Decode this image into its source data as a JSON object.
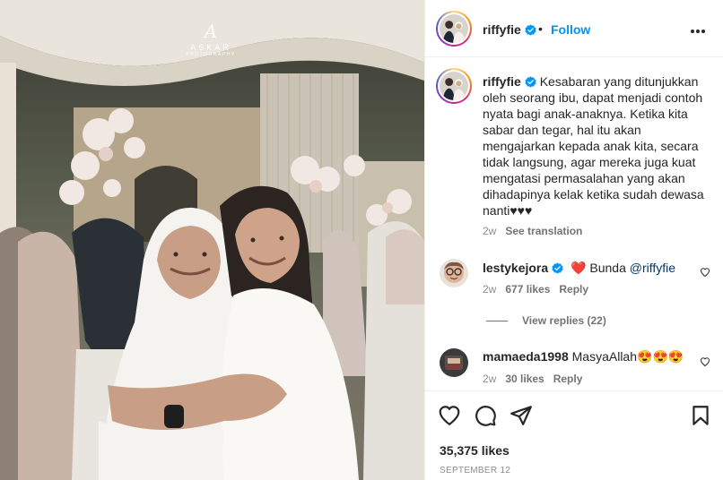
{
  "post": {
    "author": "riffyfie",
    "follow_label": "Follow",
    "separator": "•",
    "caption_text": "Kesabaran yang ditunjukkan oleh seorang ibu, dapat menjadi contoh nyata bagi anak-anaknya. Ketika kita sabar dan tegar, hal itu akan mengajarkan kepada anak kita, secara tidak langsung, agar mereka juga kuat mengatasi permasalahan yang akan dihadapinya kelak ketika sudah dewasa nanti♥♥♥",
    "caption_age": "2w",
    "see_translation": "See translation",
    "likes": "35,375 likes",
    "date": "SEPTEMBER 12"
  },
  "watermark": {
    "mark": "A",
    "name": "ASKAR",
    "sub": "PHOTOGRAPHY"
  },
  "comments": [
    {
      "user": "lestykejora",
      "heart": "❤️",
      "text": "Bunda ",
      "mention": "@riffyfie",
      "age": "2w",
      "likes": "677 likes",
      "reply": "Reply"
    },
    {
      "user": "mamaeda1998",
      "text": "MasyaAllah",
      "emojis": "😍😍😍",
      "age": "2w",
      "likes": "30 likes",
      "reply": "Reply"
    }
  ],
  "view_replies": "View replies (22)",
  "icons": {
    "like": "heart-icon",
    "comment": "comment-icon",
    "share": "share-icon",
    "save": "bookmark-icon",
    "more": "more-icon",
    "verified": "verified-badge-icon"
  },
  "colors": {
    "follow": "#0095f6",
    "verified": "#0095f6",
    "secondary_text": "#8e8e8e",
    "primary_text": "#262626",
    "mention": "#00376b"
  }
}
